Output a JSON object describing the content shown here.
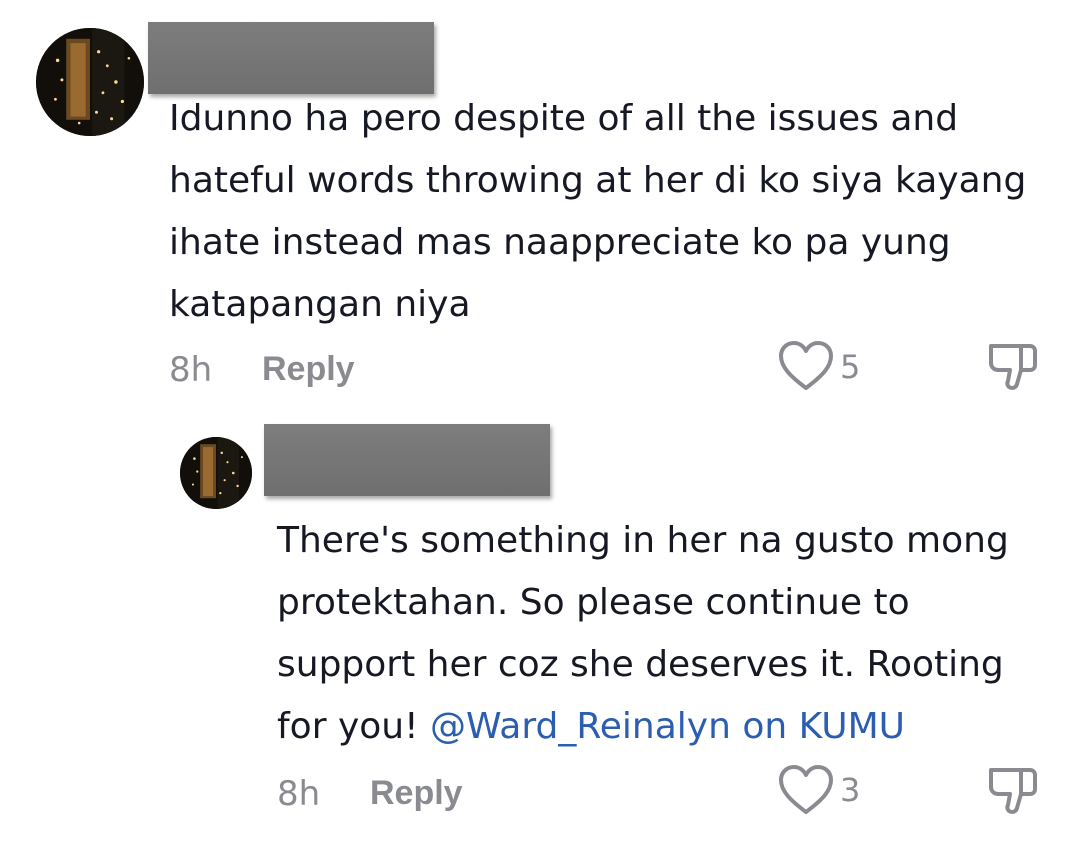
{
  "comments": [
    {
      "text": "Idunno ha pero despite of all the issues and hateful words throwing at her di ko siya kayang ihate instead mas naappreciate ko pa yung katapangan niya",
      "time": "8h",
      "reply_label": "Reply",
      "likes": "5"
    }
  ],
  "replies": [
    {
      "text": "There's something in her na gusto mong protektahan. So please continue to support her coz she deserves it. Rooting for you!",
      "mention": "@Ward_Reinalyn on KUMU",
      "time": "8h",
      "reply_label": "Reply",
      "likes": "3"
    }
  ],
  "icons": {
    "like": "heart-outline-icon",
    "dislike": "thumbs-down-icon"
  },
  "colors": {
    "text": "#161823",
    "meta": "#8a8b91",
    "mention": "#2b5db0",
    "redaction": "#757575"
  }
}
